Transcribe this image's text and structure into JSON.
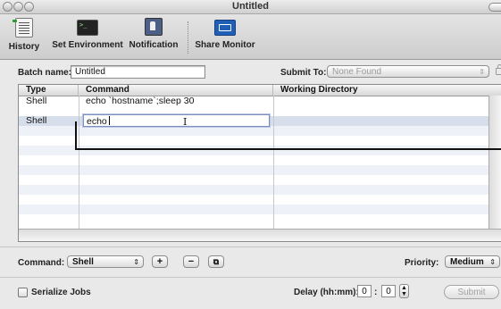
{
  "window": {
    "title": "Untitled"
  },
  "toolbar": {
    "history": "History",
    "set_environment": "Set Environment",
    "notification": "Notification",
    "share_monitor": "Share Monitor"
  },
  "batch": {
    "name_label": "Batch name:",
    "name_value": "Untitled",
    "submit_to_label": "Submit To:",
    "submit_to_value": "None Found"
  },
  "table": {
    "columns": [
      "Type",
      "Command",
      "Working Directory"
    ],
    "rows": [
      {
        "type": "Shell",
        "command": "echo `hostname`;sleep 30",
        "dir": ""
      },
      {
        "type": "Shell",
        "command": "echo",
        "dir": ""
      }
    ]
  },
  "controls": {
    "command_label": "Command:",
    "command_value": "Shell",
    "add_symbol": "+",
    "remove_symbol": "−",
    "priority_label": "Priority:",
    "priority_value": "Medium",
    "serialize_label": "Serialize Jobs",
    "delay_label": "Delay (hh:mm):",
    "delay_hours": "0",
    "delay_minutes": "0",
    "delay_separator": ":",
    "submit_label": "Submit"
  },
  "icons": {
    "history": "history-icon",
    "set_environment": "terminal-icon",
    "notification": "notification-icon",
    "share_monitor": "share-monitor-icon"
  }
}
